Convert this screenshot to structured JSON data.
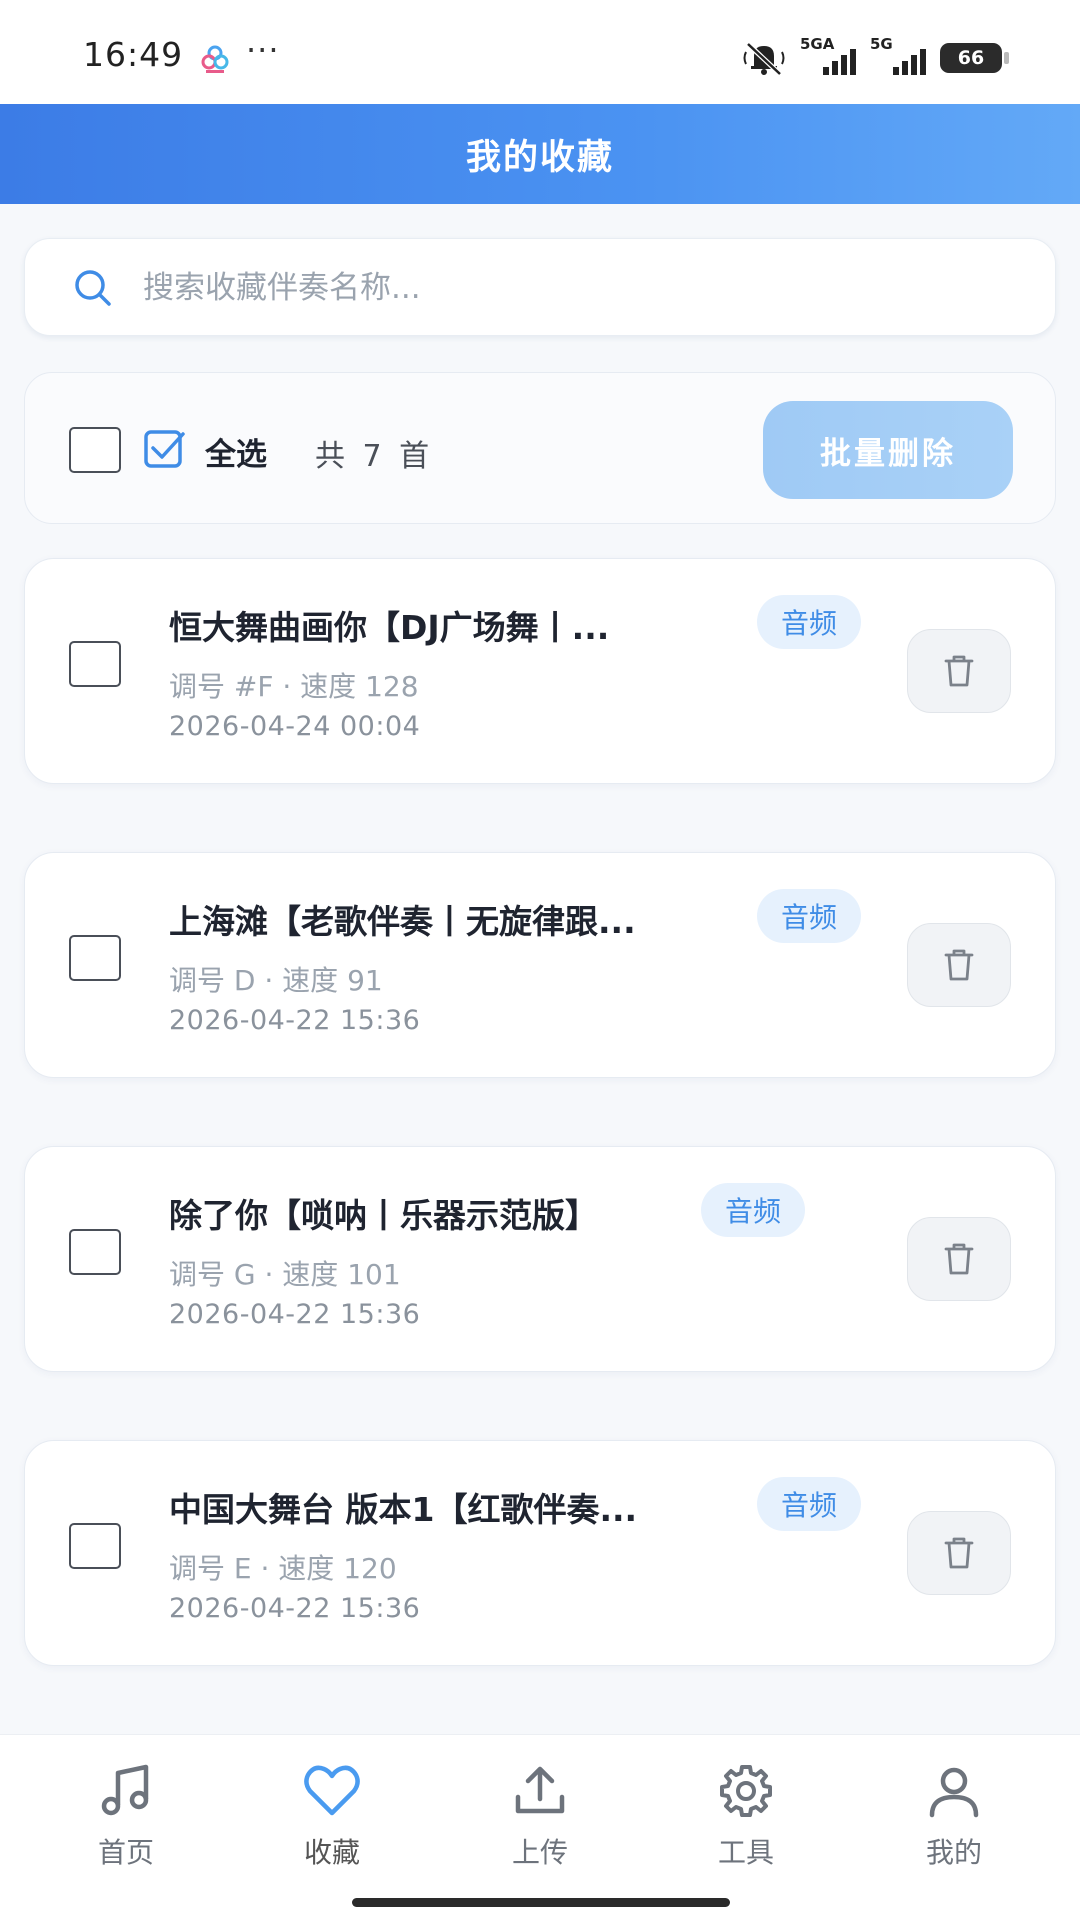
{
  "status_bar": {
    "time": "16:49",
    "dots": "···",
    "signal1_label": "5GA",
    "signal2_label": "5G",
    "battery": "66"
  },
  "header": {
    "title": "我的收藏"
  },
  "search": {
    "placeholder": "搜索收藏伴奏名称..."
  },
  "toolbar": {
    "select_all_label": "全选",
    "count_text": "共 7 首",
    "batch_delete_label": "批量删除"
  },
  "items": [
    {
      "title": "恒大舞曲画你【DJ广场舞丨...",
      "tag": "音频",
      "meta": "调号 #F · 速度 128",
      "date": "2026-04-24 00:04"
    },
    {
      "title": "上海滩【老歌伴奏丨无旋律跟...",
      "tag": "音频",
      "meta": "调号 D · 速度 91",
      "date": "2026-04-22 15:36"
    },
    {
      "title": "除了你【唢呐丨乐器示范版】",
      "tag": "音频",
      "meta": "调号 G · 速度 101",
      "date": "2026-04-22 15:36"
    },
    {
      "title": "中国大舞台 版本1【红歌伴奏...",
      "tag": "音频",
      "meta": "调号 E · 速度 120",
      "date": "2026-04-22 15:36"
    }
  ],
  "nav": [
    {
      "label": "首页",
      "icon": "music-note-icon"
    },
    {
      "label": "收藏",
      "icon": "heart-icon",
      "active": true
    },
    {
      "label": "上传",
      "icon": "upload-icon"
    },
    {
      "label": "工具",
      "icon": "gear-icon"
    },
    {
      "label": "我的",
      "icon": "user-icon"
    }
  ],
  "colors": {
    "accent": "#4a90f0",
    "tag_bg": "#e6f1fd",
    "tag_text": "#3f8ce6",
    "batch_button": "#a5cef6"
  }
}
